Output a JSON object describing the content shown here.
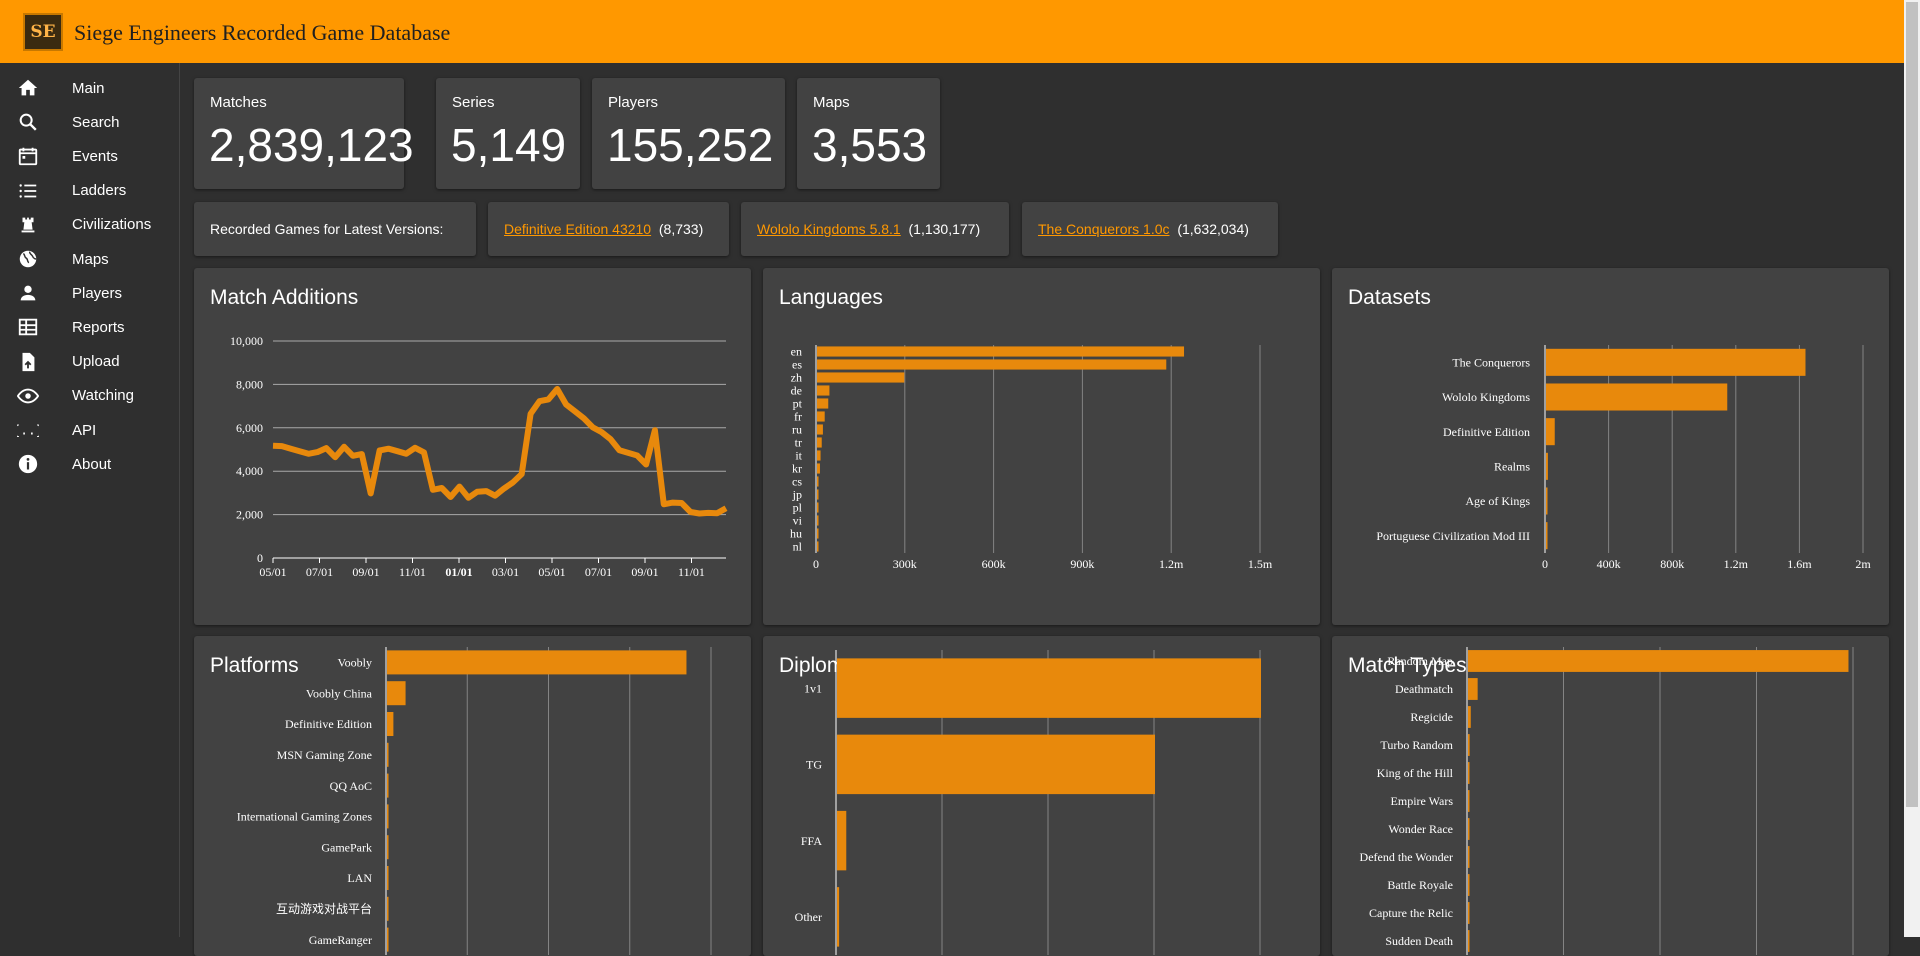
{
  "app": {
    "title": "Siege Engineers Recorded Game Database",
    "logo_text": "SE"
  },
  "sidebar": {
    "items": [
      {
        "label": "Main",
        "icon": "home-icon"
      },
      {
        "label": "Search",
        "icon": "search-icon"
      },
      {
        "label": "Events",
        "icon": "calendar-icon"
      },
      {
        "label": "Ladders",
        "icon": "list-icon"
      },
      {
        "label": "Civilizations",
        "icon": "castle-rook-icon"
      },
      {
        "label": "Maps",
        "icon": "globe-icon"
      },
      {
        "label": "Players",
        "icon": "person-icon"
      },
      {
        "label": "Reports",
        "icon": "table-icon"
      },
      {
        "label": "Upload",
        "icon": "file-upload-icon"
      },
      {
        "label": "Watching",
        "icon": "eye-icon"
      },
      {
        "label": "API",
        "icon": "code-braces-icon"
      },
      {
        "label": "About",
        "icon": "info-icon"
      }
    ]
  },
  "stats": [
    {
      "label": "Matches",
      "value": "2,839,123"
    },
    {
      "label": "Series",
      "value": "5,149"
    },
    {
      "label": "Players",
      "value": "155,252"
    },
    {
      "label": "Maps",
      "value": "3,553"
    }
  ],
  "versions": {
    "label": "Recorded Games for Latest Versions:",
    "items": [
      {
        "name": "Definitive Edition 43210",
        "count": "(8,733)"
      },
      {
        "name": "Wololo Kingdoms 5.8.1",
        "count": "(1,130,177)"
      },
      {
        "name": "The Conquerors 1.0c",
        "count": "(1,632,034)"
      }
    ]
  },
  "colors": {
    "accent": "#ff9800",
    "bar": "#e8890c",
    "card": "#424242",
    "background": "#2f2f2f"
  },
  "panels": {
    "match_additions": "Match Additions",
    "languages": "Languages",
    "datasets": "Datasets",
    "platforms": "Platforms",
    "diplomacy": "Diplomacy",
    "match_types": "Match Types"
  },
  "chart_data": [
    {
      "type": "line",
      "title": "Match Additions",
      "xlabel": "",
      "ylabel": "",
      "x_ticks": [
        "05/01",
        "07/01",
        "09/01",
        "11/01",
        "01/01",
        "03/01",
        "05/01",
        "07/01",
        "09/01",
        "11/01"
      ],
      "y_ticks": [
        "0",
        "2,000",
        "4,000",
        "6,000",
        "8,000",
        "10,000"
      ],
      "ylim": [
        0,
        10000
      ],
      "grid": true,
      "series": [
        {
          "values": [
            5400,
            5200,
            4900,
            5100,
            4800,
            4700,
            5200,
            4600,
            4900,
            4800,
            4700,
            3200,
            5000,
            4900,
            5100,
            4800,
            4900,
            5000,
            3100,
            3000,
            2900,
            3200,
            3000,
            3100,
            2950,
            3050,
            3200,
            3300,
            4000,
            6600,
            7000,
            7400,
            7700,
            7300,
            6800,
            6300,
            6200,
            5800,
            5300,
            5100,
            4800,
            4500,
            4400,
            5800,
            2700,
            2600,
            2400,
            2300,
            2050,
            1900,
            2200,
            2250
          ]
        }
      ]
    },
    {
      "type": "bar",
      "title": "Languages",
      "orientation": "horizontal",
      "categories": [
        "en",
        "es",
        "zh",
        "de",
        "pt",
        "fr",
        "ru",
        "tr",
        "it",
        "kr",
        "cs",
        "jp",
        "pl",
        "vi",
        "hu",
        "nl"
      ],
      "values": [
        1240000,
        1180000,
        295000,
        42000,
        38000,
        26000,
        20000,
        16000,
        12000,
        10000,
        5000,
        4000,
        3000,
        2000,
        1500,
        1000
      ],
      "x_ticks": [
        "0",
        "300k",
        "600k",
        "900k",
        "1.2m",
        "1.5m"
      ],
      "xlim": [
        0,
        1500000
      ],
      "grid": true
    },
    {
      "type": "bar",
      "title": "Datasets",
      "orientation": "horizontal",
      "categories": [
        "The Conquerors",
        "Wololo Kingdoms",
        "Definitive Edition",
        "Realms",
        "Age of Kings",
        "Portuguese Civilization Mod III"
      ],
      "values": [
        1632034,
        1140000,
        55000,
        12000,
        2000,
        1000
      ],
      "x_ticks": [
        "0",
        "400k",
        "800k",
        "1.2m",
        "1.6m",
        "2m"
      ],
      "xlim": [
        0,
        2000000
      ],
      "grid": true
    },
    {
      "type": "bar",
      "title": "Platforms",
      "orientation": "horizontal",
      "categories": [
        "Voobly",
        "Voobly China",
        "Definitive Edition",
        "MSN Gaming Zone",
        "QQ AoC",
        "International Gaming Zones",
        "GamePark",
        "LAN",
        "互动游戏对战平台",
        "GameRanger"
      ],
      "values": [
        2580000,
        160000,
        55000,
        8000,
        6000,
        4000,
        3000,
        2000,
        1500,
        1000
      ],
      "xlim": [
        0,
        2800000
      ],
      "grid": true
    },
    {
      "type": "bar",
      "title": "Diplomacy",
      "orientation": "horizontal",
      "categories": [
        "1v1",
        "TG",
        "FFA",
        "Other"
      ],
      "values": [
        1600000,
        1200000,
        35000,
        8000
      ],
      "xlim": [
        0,
        1600000
      ],
      "grid": true
    },
    {
      "type": "bar",
      "title": "Match Types",
      "orientation": "horizontal",
      "categories": [
        "Random Map",
        "Deathmatch",
        "Regicide",
        "Turbo Random",
        "King of the Hill",
        "Empire Wars",
        "Wonder Race",
        "Defend the Wonder",
        "Battle Royale",
        "Capture the Relic",
        "Sudden Death"
      ],
      "values": [
        2760000,
        70000,
        20000,
        12000,
        8000,
        6000,
        5000,
        4000,
        3000,
        2000,
        1000
      ],
      "xlim": [
        0,
        2800000
      ],
      "grid": true
    }
  ]
}
